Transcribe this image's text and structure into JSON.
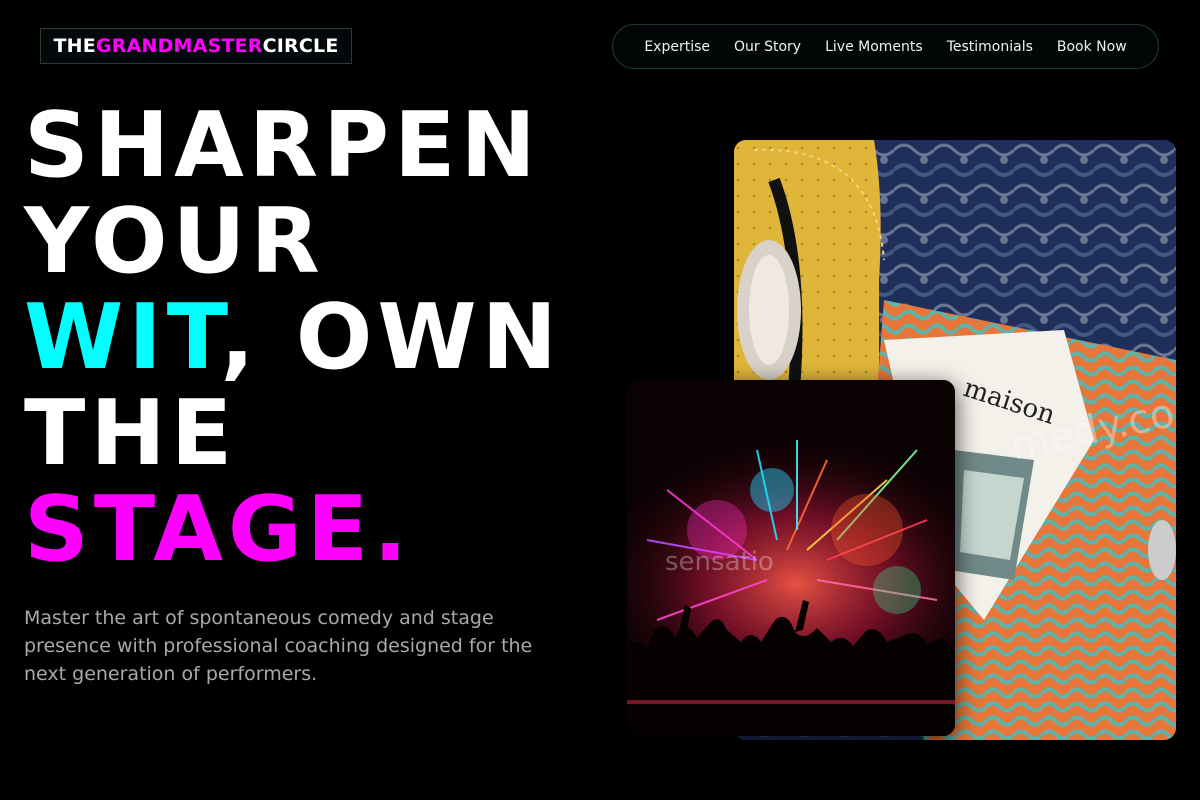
{
  "brand": {
    "part1": "THE ",
    "part2": "GRANDMASTER",
    "part3": " CIRCLE"
  },
  "nav": {
    "items": [
      {
        "label": "Expertise"
      },
      {
        "label": "Our Story"
      },
      {
        "label": "Live Moments"
      },
      {
        "label": "Testimonials"
      },
      {
        "label": "Book Now"
      }
    ]
  },
  "hero": {
    "line1": "SHARPEN",
    "line2": "YOUR",
    "line3_highlight": "WIT",
    "line3_rest": ", OWN",
    "line4": "THE",
    "line5": "STAGE.",
    "subtitle": "Master the art of spontaneous comedy and stage presence with professional coaching designed for the next generation of performers."
  },
  "photos": {
    "back": {
      "magazine_title": "maison",
      "watermark": "medy.com"
    },
    "front": {
      "watermark": "sensatio"
    }
  },
  "colors": {
    "background": "#000000",
    "accent_cyan": "#00ffff",
    "accent_magenta": "#ff00ff",
    "text_muted": "#a6aaae"
  }
}
